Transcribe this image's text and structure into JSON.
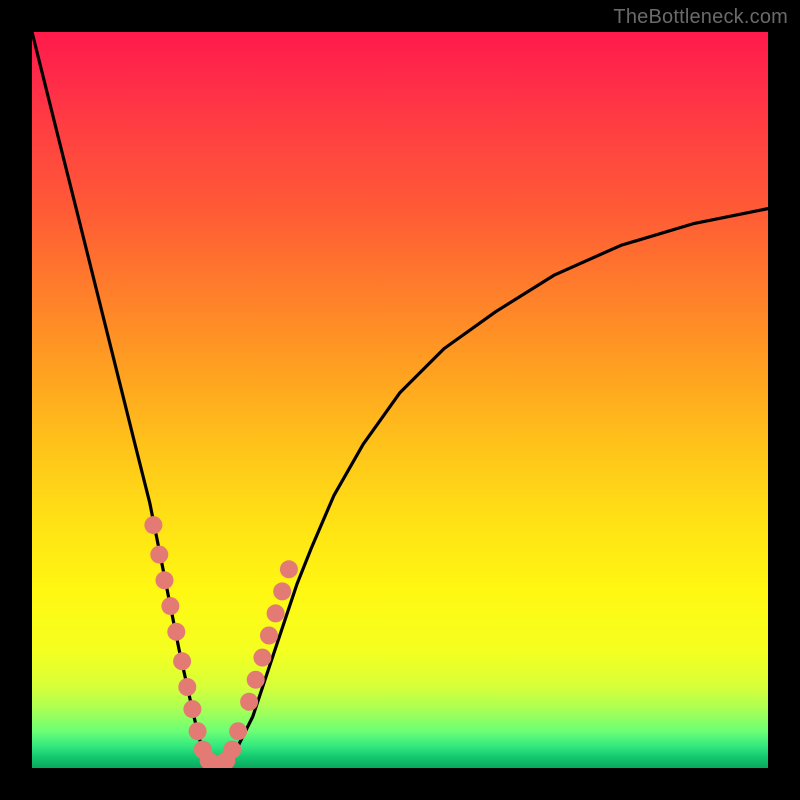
{
  "watermark": "TheBottleneck.com",
  "colors": {
    "frame": "#000000",
    "curve": "#000000",
    "marker": "#e47a74",
    "gradient_top": "#ff1a4b",
    "gradient_bottom": "#0aa75e"
  },
  "chart_data": {
    "type": "line",
    "title": "",
    "xlabel": "",
    "ylabel": "",
    "xlim": [
      0,
      100
    ],
    "ylim": [
      0,
      100
    ],
    "series": [
      {
        "name": "bottleneck-curve",
        "x": [
          0,
          2,
          4,
          6,
          8,
          10,
          12,
          14,
          16,
          18,
          20,
          22,
          23,
          24,
          25,
          26,
          27,
          28,
          30,
          32,
          34,
          36,
          38,
          41,
          45,
          50,
          56,
          63,
          71,
          80,
          90,
          100
        ],
        "values": [
          100,
          92,
          84,
          76,
          68,
          60,
          52,
          44,
          36,
          26,
          16,
          7,
          3,
          1,
          0.5,
          0.5,
          1,
          3,
          7,
          13,
          19,
          25,
          30,
          37,
          44,
          51,
          57,
          62,
          67,
          71,
          74,
          76
        ]
      }
    ],
    "markers": {
      "name": "highlighted-points",
      "x": [
        16.5,
        17.3,
        18.0,
        18.8,
        19.6,
        20.4,
        21.1,
        21.8,
        22.5,
        23.2,
        24.0,
        24.8,
        25.6,
        26.4,
        27.2,
        28.0,
        29.5,
        30.4,
        31.3,
        32.2,
        33.1,
        34.0,
        34.9
      ],
      "values": [
        33,
        29,
        25.5,
        22,
        18.5,
        14.5,
        11,
        8,
        5,
        2.5,
        1,
        0.5,
        0.5,
        1,
        2.5,
        5,
        9,
        12,
        15,
        18,
        21,
        24,
        27
      ]
    }
  }
}
